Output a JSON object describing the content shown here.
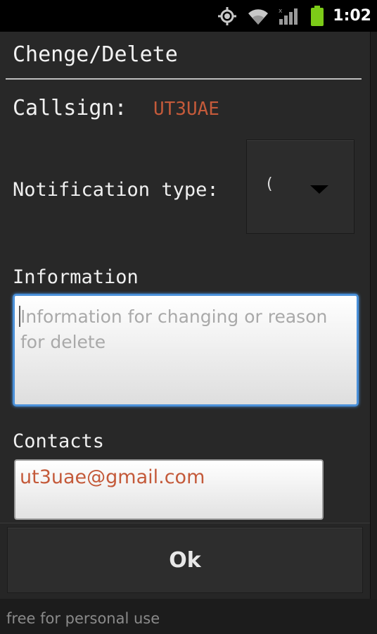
{
  "status_bar": {
    "time": "1:02",
    "icons": [
      "gps-icon",
      "wifi-icon",
      "signal-icon",
      "battery-icon"
    ],
    "battery_color": "#7ccb18"
  },
  "dialog": {
    "title": "Chenge/Delete",
    "callsign_label": "Callsign:",
    "callsign_value": "UT3UAE",
    "notification_label": "Notification type:",
    "notification_selected": "(",
    "information_label": "Information",
    "information_placeholder": "Information for changing or reason for delete",
    "contacts_label": "Contacts",
    "contacts_value": "ut3uae@gmail.com",
    "ok_label": "Ok"
  },
  "footer": {
    "text": "free for personal use"
  },
  "colors": {
    "accent_value": "#c45a3a",
    "focus_border": "#4a90d9"
  }
}
